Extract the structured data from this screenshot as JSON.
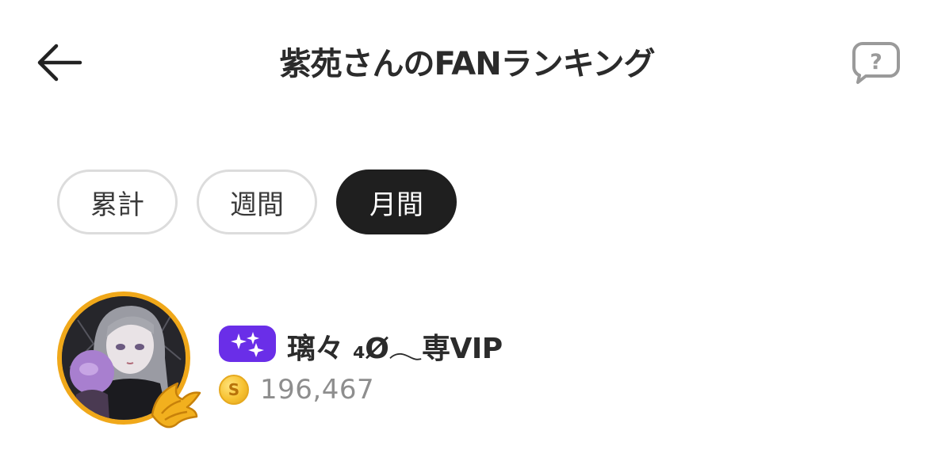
{
  "header": {
    "title": "紫苑さんのFANランキング",
    "back_icon": "arrow-left-icon",
    "help_icon": "question-bubble-icon"
  },
  "tabs": [
    {
      "label": "累計",
      "active": false
    },
    {
      "label": "週間",
      "active": false
    },
    {
      "label": "月間",
      "active": true
    }
  ],
  "ranking": [
    {
      "name": "璃々 ₄Ø𓂃専VIP",
      "badge_icon": "sparkle-badge-icon",
      "badge_color": "#6a2ee8",
      "coin_icon": "coin-icon",
      "coins": "196,467",
      "avatar_ring_color": "#f0a81a"
    }
  ]
}
